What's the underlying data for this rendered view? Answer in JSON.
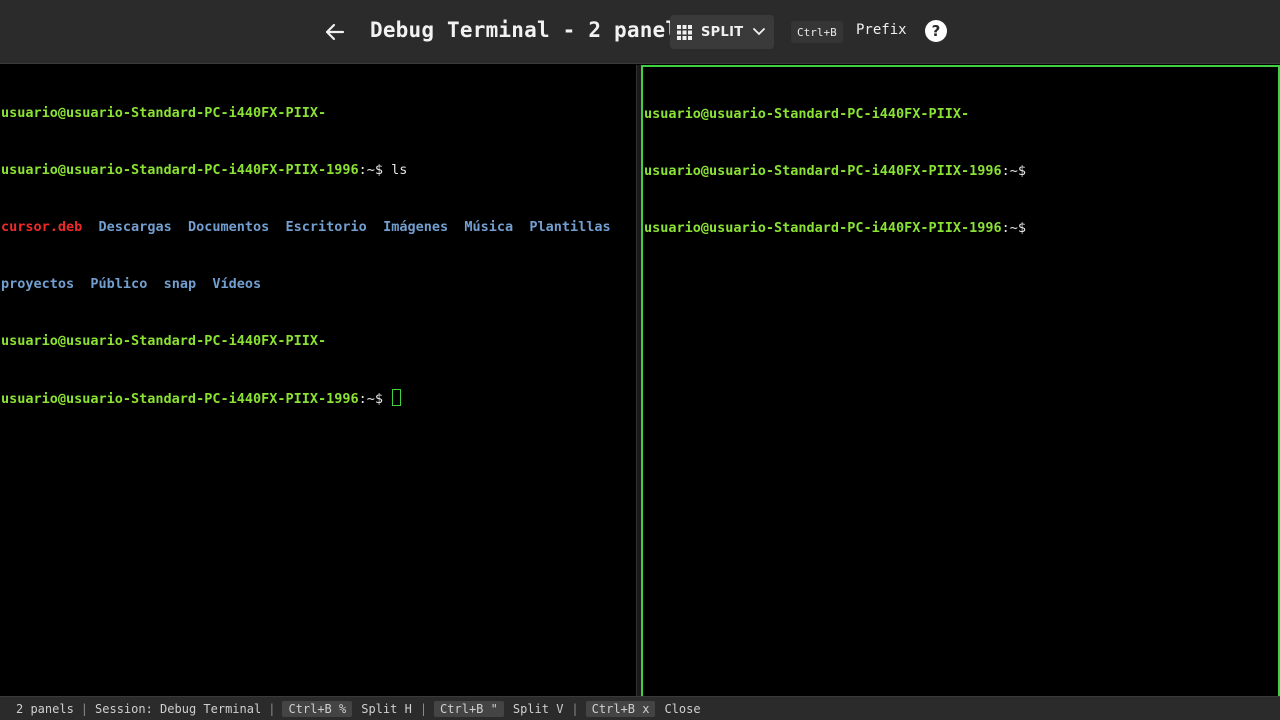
{
  "header": {
    "title": "Debug Terminal - 2 panels",
    "split_label": "SPLIT",
    "prefix_key": "Ctrl+B",
    "prefix_label": "Prefix",
    "help_label": "?"
  },
  "left_panel": {
    "prompt_user_line1": "usuario@usuario-Standard-PC-i440FX-PIIX-",
    "prompt_user_line2": "usuario@usuario-Standard-PC-i440FX-PIIX-1996",
    "prompt_suffix": ":~$",
    "command": " ls",
    "ls_row1": [
      "cursor.deb",
      "Descargas",
      "Documentos",
      "Escritorio",
      "Imágenes",
      "Música",
      "Plantillas"
    ],
    "ls_row2": [
      "proyectos",
      "Público",
      "snap",
      "Vídeos"
    ]
  },
  "right_panel": {
    "prompt_user_line1": "usuario@usuario-Standard-PC-i440FX-PIIX-",
    "prompt_user_line2": "usuario@usuario-Standard-PC-i440FX-PIIX-1996",
    "prompt_suffix": ":~$"
  },
  "statusbar": {
    "panels": "2 panels",
    "session": "Session: Debug Terminal",
    "key_split_h": "Ctrl+B %",
    "label_split_h": "Split H",
    "key_split_v": "Ctrl+B \"",
    "label_split_v": "Split V",
    "key_close": "Ctrl+B x",
    "label_close": "Close"
  },
  "colors": {
    "prompt": "#8ae234",
    "directory": "#729fcf",
    "archive": "#ef2929",
    "active_border": "#3fd13f"
  }
}
